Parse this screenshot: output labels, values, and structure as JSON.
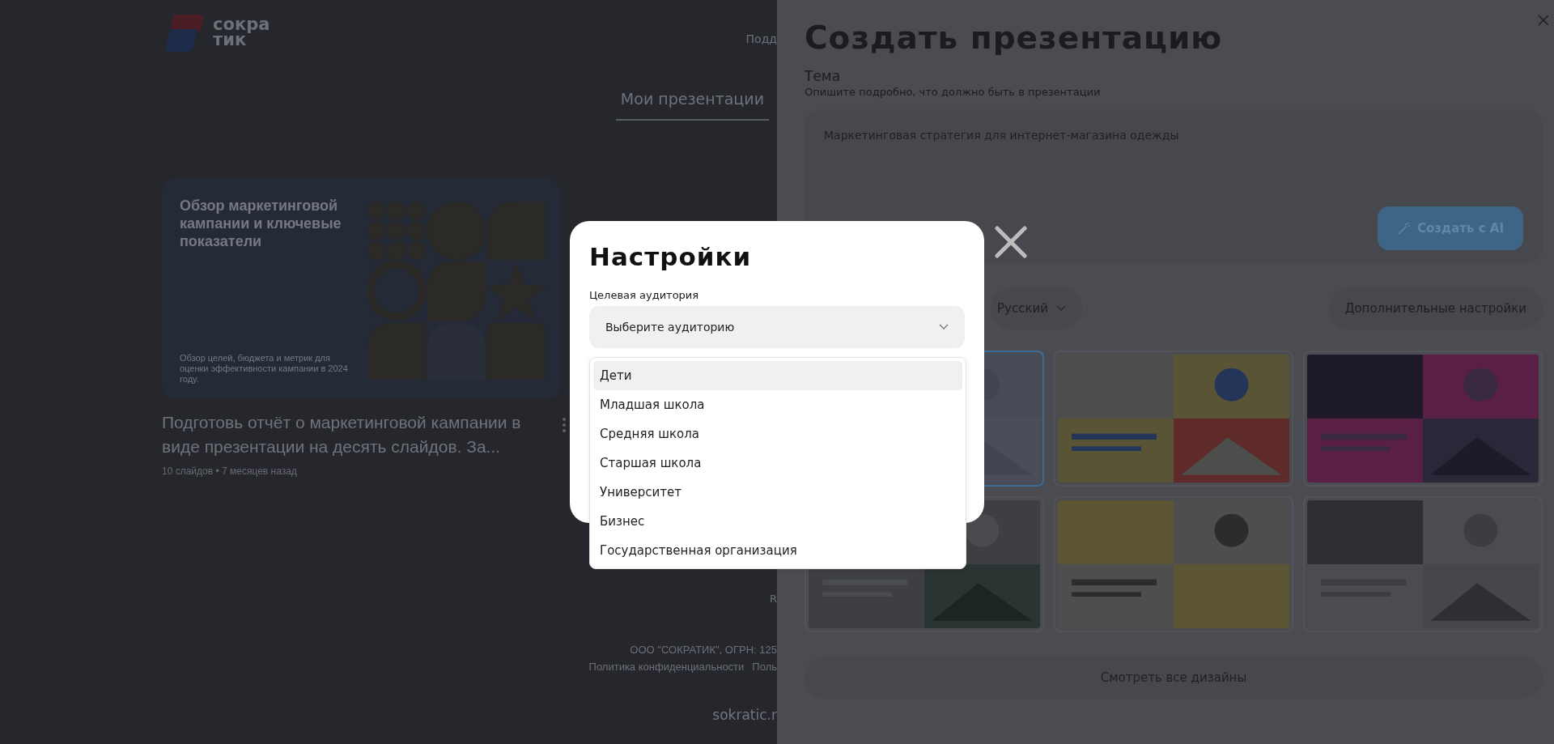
{
  "page": {
    "logo": [
      "сокра",
      "тик"
    ],
    "nav_partial": "Подд",
    "tabs": [
      {
        "label": "Мои презентации",
        "selected": true
      }
    ],
    "presentations": [
      {
        "cover_title": "Обзор маркетинговой кампании и ключевые показатели",
        "cover_description": "Обзор целей, бюджета и метрик для оценки эффективности кампании в 2024 году.",
        "title": "Подготовь отчёт о маркетинговой кампании в виде презентации на десять слайдов. За...",
        "meta": "10 слайдов • 7 месяцев назад"
      }
    ],
    "footer": {
      "partial_letter": "R",
      "company": "ООО \"СОКРАТИК\", ОГРН: 125",
      "links": [
        "Политика конфиденциальности",
        "Поль"
      ],
      "site": "sokratic.r"
    }
  },
  "drawer": {
    "title": "Создать презентацию",
    "topic_label": "Тема",
    "topic_hint": "Опишите подробно, что должно быть в презентации",
    "topic_value": "Маркетинговая стратегия для интернет-магазина одежды",
    "generate_button": "Создать с AI",
    "language": "Русский",
    "extra_settings_button": "Дополнительные настройки",
    "designs": [
      {
        "kind": "picture",
        "selected": true
      },
      {
        "kind": "picture",
        "selected": false
      },
      {
        "kind": "picture",
        "selected": false
      },
      {
        "kind": "picture",
        "selected": false
      },
      {
        "kind": "picture",
        "selected": false
      },
      {
        "kind": "picture",
        "selected": false
      }
    ],
    "view_all_button": "Смотреть все дизайны"
  },
  "modal": {
    "title": "Настройки",
    "field_label": "Целевая аудитория",
    "placeholder": "Выберите аудиторию",
    "options": [
      {
        "label": "Дети",
        "highlighted": true
      },
      {
        "label": "Младшая школа",
        "highlighted": false
      },
      {
        "label": "Средняя школа",
        "highlighted": false
      },
      {
        "label": "Старшая школа",
        "highlighted": false
      },
      {
        "label": "Университет",
        "highlighted": false
      },
      {
        "label": "Бизнес",
        "highlighted": false
      },
      {
        "label": "Государственная организация",
        "highlighted": false
      }
    ]
  }
}
